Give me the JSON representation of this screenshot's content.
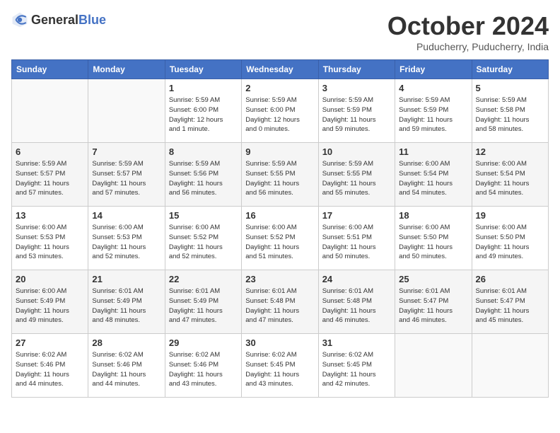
{
  "header": {
    "logo_general": "General",
    "logo_blue": "Blue",
    "month_title": "October 2024",
    "location": "Puducherry, Puducherry, India"
  },
  "weekdays": [
    "Sunday",
    "Monday",
    "Tuesday",
    "Wednesday",
    "Thursday",
    "Friday",
    "Saturday"
  ],
  "weeks": [
    [
      {
        "day": "",
        "info": ""
      },
      {
        "day": "",
        "info": ""
      },
      {
        "day": "1",
        "info": "Sunrise: 5:59 AM\nSunset: 6:00 PM\nDaylight: 12 hours\nand 1 minute."
      },
      {
        "day": "2",
        "info": "Sunrise: 5:59 AM\nSunset: 6:00 PM\nDaylight: 12 hours\nand 0 minutes."
      },
      {
        "day": "3",
        "info": "Sunrise: 5:59 AM\nSunset: 5:59 PM\nDaylight: 11 hours\nand 59 minutes."
      },
      {
        "day": "4",
        "info": "Sunrise: 5:59 AM\nSunset: 5:59 PM\nDaylight: 11 hours\nand 59 minutes."
      },
      {
        "day": "5",
        "info": "Sunrise: 5:59 AM\nSunset: 5:58 PM\nDaylight: 11 hours\nand 58 minutes."
      }
    ],
    [
      {
        "day": "6",
        "info": "Sunrise: 5:59 AM\nSunset: 5:57 PM\nDaylight: 11 hours\nand 57 minutes."
      },
      {
        "day": "7",
        "info": "Sunrise: 5:59 AM\nSunset: 5:57 PM\nDaylight: 11 hours\nand 57 minutes."
      },
      {
        "day": "8",
        "info": "Sunrise: 5:59 AM\nSunset: 5:56 PM\nDaylight: 11 hours\nand 56 minutes."
      },
      {
        "day": "9",
        "info": "Sunrise: 5:59 AM\nSunset: 5:55 PM\nDaylight: 11 hours\nand 56 minutes."
      },
      {
        "day": "10",
        "info": "Sunrise: 5:59 AM\nSunset: 5:55 PM\nDaylight: 11 hours\nand 55 minutes."
      },
      {
        "day": "11",
        "info": "Sunrise: 6:00 AM\nSunset: 5:54 PM\nDaylight: 11 hours\nand 54 minutes."
      },
      {
        "day": "12",
        "info": "Sunrise: 6:00 AM\nSunset: 5:54 PM\nDaylight: 11 hours\nand 54 minutes."
      }
    ],
    [
      {
        "day": "13",
        "info": "Sunrise: 6:00 AM\nSunset: 5:53 PM\nDaylight: 11 hours\nand 53 minutes."
      },
      {
        "day": "14",
        "info": "Sunrise: 6:00 AM\nSunset: 5:53 PM\nDaylight: 11 hours\nand 52 minutes."
      },
      {
        "day": "15",
        "info": "Sunrise: 6:00 AM\nSunset: 5:52 PM\nDaylight: 11 hours\nand 52 minutes."
      },
      {
        "day": "16",
        "info": "Sunrise: 6:00 AM\nSunset: 5:52 PM\nDaylight: 11 hours\nand 51 minutes."
      },
      {
        "day": "17",
        "info": "Sunrise: 6:00 AM\nSunset: 5:51 PM\nDaylight: 11 hours\nand 50 minutes."
      },
      {
        "day": "18",
        "info": "Sunrise: 6:00 AM\nSunset: 5:50 PM\nDaylight: 11 hours\nand 50 minutes."
      },
      {
        "day": "19",
        "info": "Sunrise: 6:00 AM\nSunset: 5:50 PM\nDaylight: 11 hours\nand 49 minutes."
      }
    ],
    [
      {
        "day": "20",
        "info": "Sunrise: 6:00 AM\nSunset: 5:49 PM\nDaylight: 11 hours\nand 49 minutes."
      },
      {
        "day": "21",
        "info": "Sunrise: 6:01 AM\nSunset: 5:49 PM\nDaylight: 11 hours\nand 48 minutes."
      },
      {
        "day": "22",
        "info": "Sunrise: 6:01 AM\nSunset: 5:49 PM\nDaylight: 11 hours\nand 47 minutes."
      },
      {
        "day": "23",
        "info": "Sunrise: 6:01 AM\nSunset: 5:48 PM\nDaylight: 11 hours\nand 47 minutes."
      },
      {
        "day": "24",
        "info": "Sunrise: 6:01 AM\nSunset: 5:48 PM\nDaylight: 11 hours\nand 46 minutes."
      },
      {
        "day": "25",
        "info": "Sunrise: 6:01 AM\nSunset: 5:47 PM\nDaylight: 11 hours\nand 46 minutes."
      },
      {
        "day": "26",
        "info": "Sunrise: 6:01 AM\nSunset: 5:47 PM\nDaylight: 11 hours\nand 45 minutes."
      }
    ],
    [
      {
        "day": "27",
        "info": "Sunrise: 6:02 AM\nSunset: 5:46 PM\nDaylight: 11 hours\nand 44 minutes."
      },
      {
        "day": "28",
        "info": "Sunrise: 6:02 AM\nSunset: 5:46 PM\nDaylight: 11 hours\nand 44 minutes."
      },
      {
        "day": "29",
        "info": "Sunrise: 6:02 AM\nSunset: 5:46 PM\nDaylight: 11 hours\nand 43 minutes."
      },
      {
        "day": "30",
        "info": "Sunrise: 6:02 AM\nSunset: 5:45 PM\nDaylight: 11 hours\nand 43 minutes."
      },
      {
        "day": "31",
        "info": "Sunrise: 6:02 AM\nSunset: 5:45 PM\nDaylight: 11 hours\nand 42 minutes."
      },
      {
        "day": "",
        "info": ""
      },
      {
        "day": "",
        "info": ""
      }
    ]
  ]
}
